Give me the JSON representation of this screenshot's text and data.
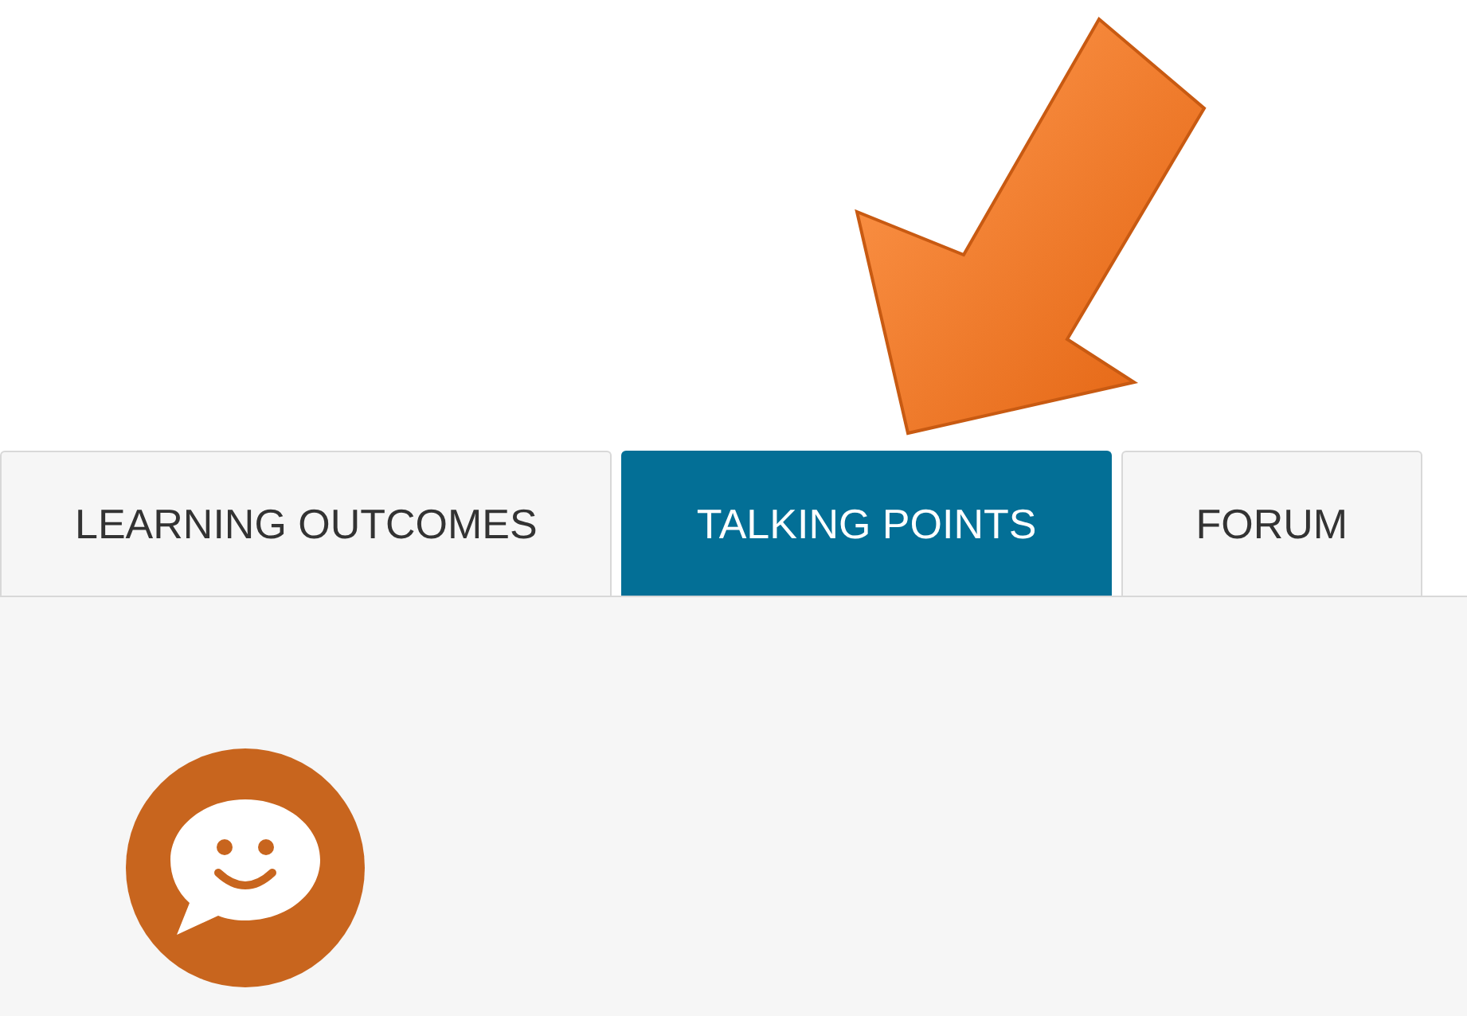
{
  "tabs": [
    {
      "label": "LEARNING OUTCOMES",
      "selected": false
    },
    {
      "label": "TALKING POINTS",
      "selected": true
    },
    {
      "label": "FORUM",
      "selected": false
    }
  ]
}
